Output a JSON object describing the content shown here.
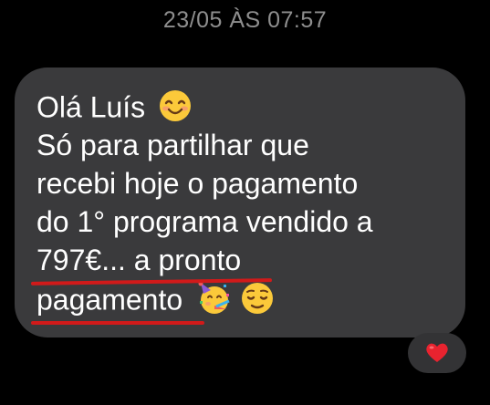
{
  "message": {
    "timestamp": "23/05 ÀS 07:57",
    "lines": [
      "Olá Luís",
      "Só para partilhar que",
      "recebi hoje o pagamento",
      "do 1° programa vendido a",
      "797€... a pronto",
      "pagamento"
    ],
    "emojis": [
      "smiling-face-icon",
      "party-face-icon",
      "relieved-face-icon"
    ]
  },
  "reaction": {
    "emoji": "heart-icon"
  },
  "colors": {
    "background": "#000000",
    "bubble": "#3a3a3c",
    "text": "#ffffff",
    "timestamp": "#8e8e8e",
    "underline": "#d11a1a",
    "heart": "#e8232f"
  }
}
